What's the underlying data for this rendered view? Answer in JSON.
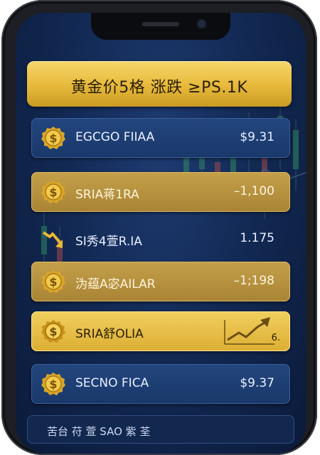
{
  "header": {
    "title": "黄金价5格 涨跌 ≥PS.1K"
  },
  "rows": [
    {
      "name": "EGCGO FIIAA",
      "value": "$9.31",
      "icon": "gold-coin-icon"
    },
    {
      "name": "SRIA蒋1RA",
      "value": "–1,100",
      "icon": "gold-coin-icon"
    },
    {
      "name": "SI秀4萱R.IA",
      "value": "1.175",
      "icon": "falling-arrow-icon"
    },
    {
      "name": "沩蕴A宓AILAR",
      "value": "–1;198",
      "icon": "gold-coin-icon"
    },
    {
      "name": "SRIA舒OLIA",
      "value": "6.",
      "icon": "gold-coin-icon",
      "trend_icon": "rising-trend-icon"
    },
    {
      "name": "SECNO FICA",
      "value": "$9.37",
      "icon": "gold-coin-icon"
    }
  ],
  "footer": {
    "text": "苦台 苻 萱 SAO 紫 荃"
  },
  "colors": {
    "gold": "#e7b93a",
    "navy": "#132a55",
    "accent_blue": "#22467e"
  }
}
